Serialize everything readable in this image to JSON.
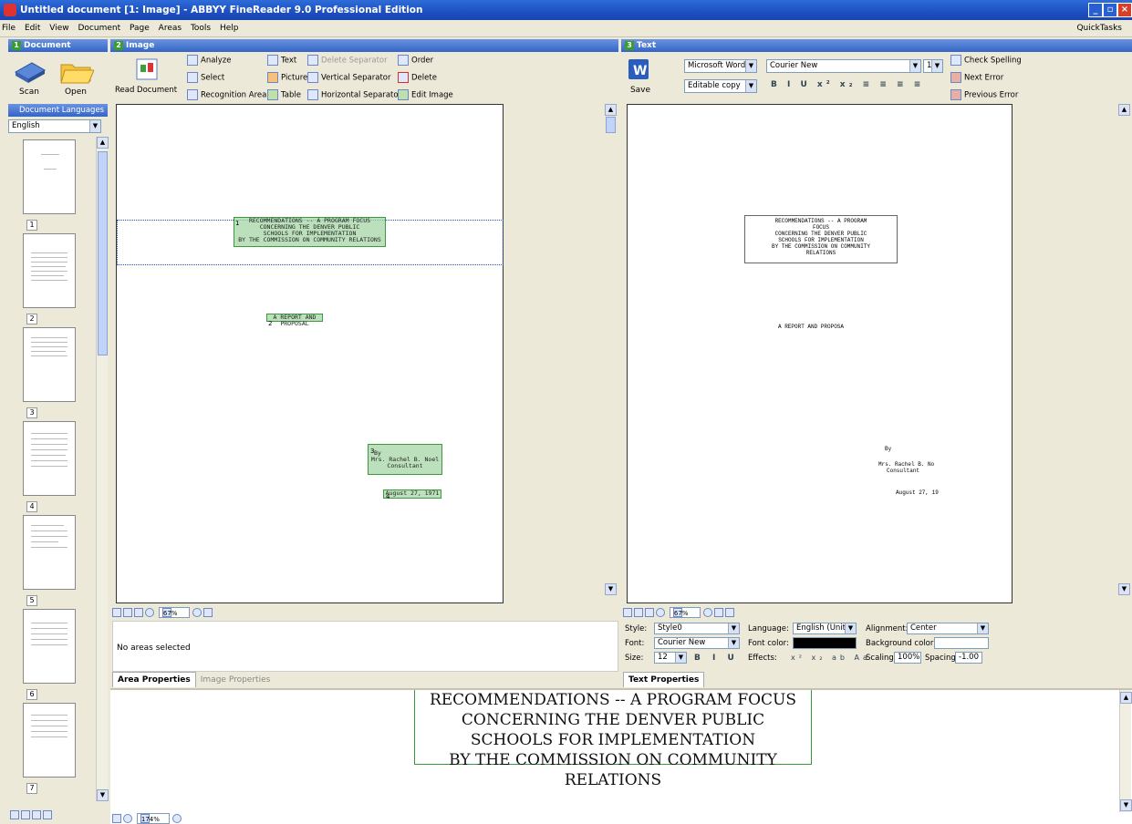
{
  "window": {
    "title": "Untitled document [1: Image] - ABBYY FineReader 9.0 Professional Edition"
  },
  "menu": [
    "File",
    "Edit",
    "View",
    "Document",
    "Page",
    "Areas",
    "Tools",
    "Help"
  ],
  "quicktasks": "QuickTasks",
  "document_pane": {
    "header": "Document",
    "scan_label": "Scan",
    "open_label": "Open",
    "languages_header": "Document Languages",
    "language": "English",
    "pages": [
      "1",
      "2",
      "3",
      "4",
      "5",
      "6",
      "7"
    ]
  },
  "image_pane": {
    "header": "Image",
    "read_document": "Read Document",
    "tools": {
      "analyze": "Analyze",
      "select": "Select",
      "recognition_area": "Recognition Area",
      "text": "Text",
      "picture": "Picture",
      "table": "Table",
      "delete_separator": "Delete Separator",
      "vertical_separator": "Vertical Separator",
      "horizontal_separator": "Horizontal Separator",
      "order": "Order",
      "delete": "Delete",
      "edit_image": "Edit Image"
    },
    "regions": {
      "r1_num": "1",
      "r1_lines": [
        "RECOMMENDATIONS -- A PROGRAM FOCUS",
        "CONCERNING THE DENVER PUBLIC",
        "SCHOOLS FOR IMPLEMENTATION",
        "BY THE COMMISSION ON COMMUNITY RELATIONS"
      ],
      "r2_num": "2",
      "r2": "A REPORT AND PROPOSAL",
      "r3_num": "3",
      "r3_lines": [
        "By",
        "Mrs. Rachel B. Noel",
        "Consultant"
      ],
      "r4_num": "4",
      "r4": "August 27, 1971"
    },
    "zoom": "67%",
    "no_areas": "No areas selected",
    "tab_area": "Area Properties",
    "tab_image": "Image Properties"
  },
  "text_pane": {
    "header": "Text",
    "save_label": "Save",
    "format": "Microsoft Word Do",
    "copy_mode": "Editable copy",
    "font": "Courier New",
    "size": "12",
    "check_spelling": "Check Spelling",
    "next_error": "Next Error",
    "previous_error": "Previous Error",
    "ocr_lines": [
      "RECOMMENDATIONS -- A PROGRAM",
      "FOCUS",
      "CONCERNING THE DENVER PUBLIC",
      "SCHOOLS FOR IMPLEMENTATION",
      "BY THE COMMISSION ON COMMUNITY",
      "RELATIONS"
    ],
    "ocr_report": "A REPORT AND PROPOSA",
    "ocr_by": "By",
    "ocr_name": "Mrs. Rachel B. No",
    "ocr_consultant": "Consultant",
    "ocr_date": "August 27, 19",
    "zoom": "67%",
    "props": {
      "style_label": "Style:",
      "style": "Style0",
      "font_label": "Font:",
      "font": "Courier New",
      "size_label": "Size:",
      "size": "12",
      "language_label": "Language:",
      "language": "English (Unit...",
      "font_color_label": "Font color:",
      "effects_label": "Effects:",
      "alignment_label": "Alignment:",
      "alignment": "Center",
      "bg_color_label": "Background color:",
      "scaling_label": "Scaling:",
      "scaling": "100%",
      "spacing_label": "Spacing:",
      "spacing": "-1.00"
    },
    "tab": "Text Properties"
  },
  "zoom_pane": {
    "lines": [
      "RECOMMENDATIONS  --  A PROGRAM FOCUS",
      "CONCERNING THE DENVER PUBLIC",
      "SCHOOLS FOR IMPLEMENTATION",
      "BY THE COMMISSION ON COMMUNITY RELATIONS"
    ],
    "zoom": "174%"
  },
  "colors": {
    "titlebar": "#2e6cd9",
    "region_fill": "#a4d6a4",
    "region_border": "#3b9a3b",
    "chrome": "#ece9d8"
  }
}
